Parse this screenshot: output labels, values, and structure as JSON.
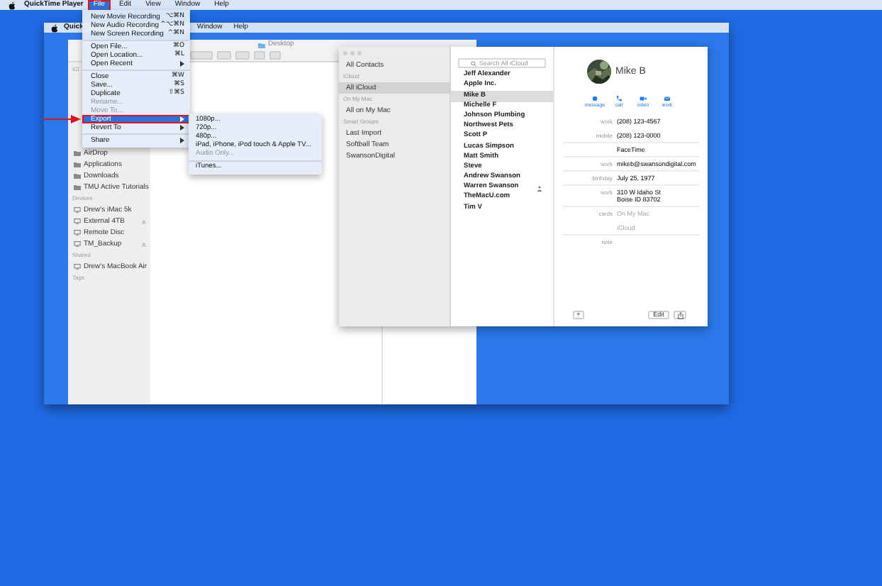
{
  "menu_bar": {
    "app_name": "QuickTime Player",
    "menus": [
      {
        "label": "File",
        "selected": true,
        "annotated": true
      },
      {
        "label": "Edit",
        "selected": false,
        "annotated": false
      },
      {
        "label": "View",
        "selected": false,
        "annotated": false
      },
      {
        "label": "Window",
        "selected": false,
        "annotated": false
      },
      {
        "label": "Help",
        "selected": false,
        "annotated": false
      }
    ]
  },
  "file_menu": {
    "items": [
      {
        "label": "New Movie Recording",
        "shortcut": "⌥⌘N",
        "disabled": false,
        "submenu": false,
        "selected": false,
        "annotated": false,
        "separator_after": false
      },
      {
        "label": "New Audio Recording",
        "shortcut": "^⌥⌘N",
        "disabled": false,
        "submenu": false,
        "selected": false,
        "annotated": false,
        "separator_after": false
      },
      {
        "label": "New Screen Recording",
        "shortcut": "^⌘N",
        "disabled": false,
        "submenu": false,
        "selected": false,
        "annotated": false,
        "separator_after": true
      },
      {
        "label": "Open File...",
        "shortcut": "⌘O",
        "disabled": false,
        "submenu": false,
        "selected": false,
        "annotated": false,
        "separator_after": false
      },
      {
        "label": "Open Location...",
        "shortcut": "⌘L",
        "disabled": false,
        "submenu": false,
        "selected": false,
        "annotated": false,
        "separator_after": false
      },
      {
        "label": "Open Recent",
        "disabled": false,
        "submenu": true,
        "selected": false,
        "annotated": false,
        "separator_after": true
      },
      {
        "label": "Close",
        "shortcut": "⌘W",
        "disabled": false,
        "submenu": false,
        "selected": false,
        "annotated": false,
        "separator_after": false
      },
      {
        "label": "Save...",
        "shortcut": "⌘S",
        "disabled": false,
        "submenu": false,
        "selected": false,
        "annotated": false,
        "separator_after": false
      },
      {
        "label": "Duplicate",
        "shortcut": "⇧⌘S",
        "disabled": false,
        "submenu": false,
        "selected": false,
        "annotated": false,
        "separator_after": false
      },
      {
        "label": "Rename...",
        "disabled": true,
        "submenu": false,
        "selected": false,
        "annotated": false,
        "separator_after": false
      },
      {
        "label": "Move To...",
        "disabled": true,
        "submenu": false,
        "selected": false,
        "annotated": false,
        "separator_after": false
      },
      {
        "label": "Export",
        "disabled": false,
        "submenu": true,
        "selected": true,
        "annotated": true,
        "separator_after": false
      },
      {
        "label": "Revert To",
        "disabled": false,
        "submenu": true,
        "selected": false,
        "annotated": false,
        "separator_after": true
      },
      {
        "label": "Share",
        "disabled": false,
        "submenu": true,
        "selected": false,
        "annotated": false,
        "separator_after": false
      }
    ]
  },
  "export_submenu": {
    "items": [
      {
        "label": "1080p...",
        "disabled": false,
        "separator_after": false
      },
      {
        "label": "720p...",
        "disabled": false,
        "separator_after": false
      },
      {
        "label": "480p...",
        "disabled": false,
        "separator_after": false
      },
      {
        "label": "iPad, iPhone, iPod touch & Apple TV...",
        "disabled": false,
        "separator_after": false
      },
      {
        "label": "Audio Only...",
        "disabled": true,
        "separator_after": true
      },
      {
        "label": "iTunes...",
        "disabled": false
      }
    ]
  },
  "pointer_arrow": true,
  "inner_screen": {
    "menu_bar": {
      "app_name": "Quick",
      "menus": [
        "Window",
        "Help"
      ]
    }
  },
  "finder": {
    "title": "Desktop",
    "sidebar_partial_header": "iCl",
    "sidebar": [
      {
        "kind": "place",
        "label": "AirDrop",
        "eject": false
      },
      {
        "kind": "place",
        "label": "Applications",
        "eject": false
      },
      {
        "kind": "place",
        "label": "Downloads",
        "eject": false
      },
      {
        "kind": "place",
        "label": "TMU Active Tutorials"
      },
      {
        "kind": "header",
        "label": "Devices"
      },
      {
        "kind": "device",
        "label": "Drew's iMac 5k",
        "eject": false
      },
      {
        "kind": "device",
        "label": "External 4TB",
        "eject": true
      },
      {
        "kind": "device",
        "label": "Remote Disc",
        "eject": false
      },
      {
        "kind": "device",
        "label": "TM_Backup",
        "eject": true
      },
      {
        "kind": "header",
        "label": "Shared"
      },
      {
        "kind": "device",
        "label": "Drew's MacBook Air"
      },
      {
        "kind": "header",
        "label": "Tags"
      }
    ]
  },
  "contacts": {
    "groups": [
      {
        "kind": "item",
        "label": "All Contacts",
        "selected": false
      },
      {
        "kind": "header",
        "label": "iCloud",
        "selected": false
      },
      {
        "kind": "item",
        "label": "All iCloud",
        "selected": true
      },
      {
        "kind": "header",
        "label": "On My Mac",
        "selected": false
      },
      {
        "kind": "item",
        "label": "All on My Mac",
        "selected": false
      },
      {
        "kind": "header",
        "label": "Smart Groups",
        "selected": false
      },
      {
        "kind": "item",
        "label": "Last Import",
        "selected": false
      },
      {
        "kind": "item",
        "label": "Softball Team",
        "selected": false
      },
      {
        "kind": "item",
        "label": "SwansonDigital",
        "selected": false
      }
    ],
    "search": {
      "placeholder": "Search All iCloud"
    },
    "list": [
      {
        "name": "Jeff Alexander",
        "selected": false,
        "me_card": false
      },
      {
        "name": "Apple Inc.",
        "selected": false,
        "me_card": false
      },
      {
        "name": "Mike B",
        "selected": true,
        "me_card": false
      },
      {
        "name": "Michelle F",
        "selected": false,
        "me_card": false
      },
      {
        "name": "Johnson Plumbing",
        "selected": false,
        "me_card": false
      },
      {
        "name": "Northwest Pets",
        "selected": false,
        "me_card": false
      },
      {
        "name": "Scott P",
        "selected": false,
        "me_card": false
      },
      {
        "name": "Lucas Simpson",
        "selected": false,
        "me_card": false
      },
      {
        "name": "Matt Smith",
        "selected": false,
        "me_card": false
      },
      {
        "name": "Steve",
        "selected": false,
        "me_card": false
      },
      {
        "name": "Andrew Swanson",
        "selected": false,
        "me_card": false
      },
      {
        "name": "Warren Swanson",
        "selected": false,
        "me_card": true
      },
      {
        "name": "TheMacU.com",
        "selected": false,
        "me_card": false
      },
      {
        "name": "Tim V",
        "selected": false,
        "me_card": false
      }
    ],
    "card": {
      "name": "Mike B",
      "actions": [
        {
          "kind": "message",
          "label": "message"
        },
        {
          "kind": "call",
          "label": "call"
        },
        {
          "kind": "video",
          "label": "video"
        },
        {
          "kind": "mail",
          "label": "work"
        }
      ],
      "fields": [
        {
          "label": "work",
          "lines": [
            "(208) 123-4567"
          ],
          "muted": false,
          "divider": false
        },
        {
          "label": "mobile",
          "lines": [
            "(208) 123-0000"
          ],
          "muted": false,
          "divider": true
        },
        {
          "lines": [
            "FaceTime"
          ],
          "muted": false,
          "divider": true
        },
        {
          "label": "work",
          "lines": [
            "mikeb@swansondigital.com"
          ],
          "muted": false,
          "divider": true
        },
        {
          "label": "birthday",
          "lines": [
            "July 25, 1977"
          ],
          "muted": false,
          "divider": true
        },
        {
          "label": "work",
          "lines": [
            "310 W Idaho St",
            "Boise ID 83702"
          ],
          "muted": false,
          "divider": true
        },
        {
          "label": "cards",
          "lines": [
            "On My Mac"
          ],
          "muted": true,
          "divider": false
        },
        {
          "lines": [
            "iCloud"
          ],
          "muted": true,
          "divider": true
        },
        {
          "label": "note",
          "divider": false
        }
      ],
      "add_button": "+",
      "edit_button": "Edit"
    }
  }
}
